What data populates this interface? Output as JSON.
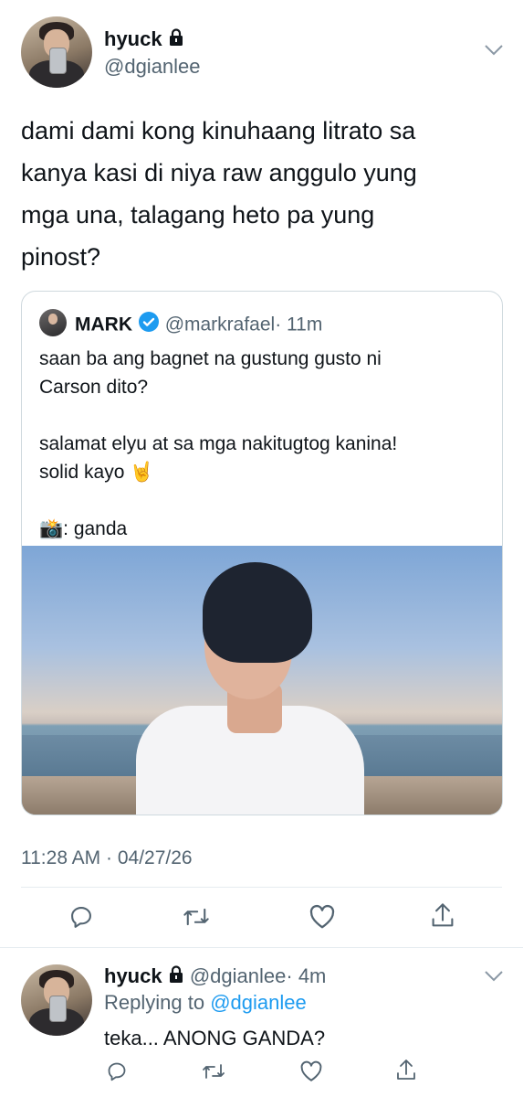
{
  "main_tweet": {
    "author_name": "hyuck",
    "author_handle": "@dgianlee",
    "text_lines": [
      "dami dami kong kinuhaang litrato sa",
      "kanya kasi di niya raw anggulo yung",
      "mga una, talagang heto pa yung",
      "pinost?"
    ],
    "timestamp": "11:28 AM · 04/27/26"
  },
  "quoted_tweet": {
    "author_name": "MARK",
    "author_handle": "@markrafael",
    "time": "· 11m",
    "line1": "saan ba ang bagnet na gustung gusto ni",
    "line2": "Carson dito?",
    "line3": "salamat elyu at sa mga nakitugtog kanina!",
    "line4": "solid kayo 🤘",
    "camera_emoji": "📸",
    "credit": ": ganda"
  },
  "reply": {
    "author_name": "hyuck",
    "author_handle": "@dgianlee",
    "time": "· 4m",
    "replying_prefix": "Replying to",
    "replying_handle": "@dgianlee",
    "text": "teka... ANONG GANDA?"
  },
  "icons": {
    "reply": "reply-icon",
    "retweet": "retweet-icon",
    "like": "like-icon",
    "share": "share-icon",
    "lock": "lock-icon",
    "verified": "verified-badge-icon",
    "more": "chevron-down-icon"
  },
  "colors": {
    "link": "#1d9bf0",
    "muted": "#536471",
    "verified": "#1d9bf0"
  }
}
